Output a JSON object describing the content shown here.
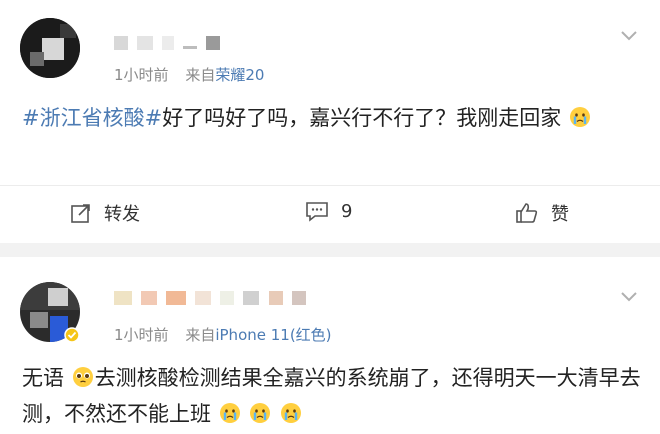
{
  "post1": {
    "username": "",
    "time": "1小时前",
    "source_prefix": "来自",
    "source_device": "荣耀20",
    "topic": "#浙江省核酸#",
    "text": "好了吗好了吗，嘉兴行不行了？我刚走回家",
    "emoji": "crying-face",
    "actions": {
      "repost_label": "转发",
      "comment_count": "9",
      "like_label": "赞"
    }
  },
  "post2": {
    "username": "",
    "time": "1小时前",
    "source_prefix": "来自",
    "source_device": "iPhone 11(红色)",
    "text_part1": "无语",
    "text_part2": "去测核酸检测结果全嘉兴的系统崩了，还得明天一大清早去测，不然还不能上班",
    "emoji_pleading": "pleading-face",
    "emoji_crying": "crying-face"
  },
  "colors": {
    "link": "#4c7bb3",
    "meta": "#8a8a8a",
    "text": "#222222",
    "background": "#f2f2f2"
  }
}
